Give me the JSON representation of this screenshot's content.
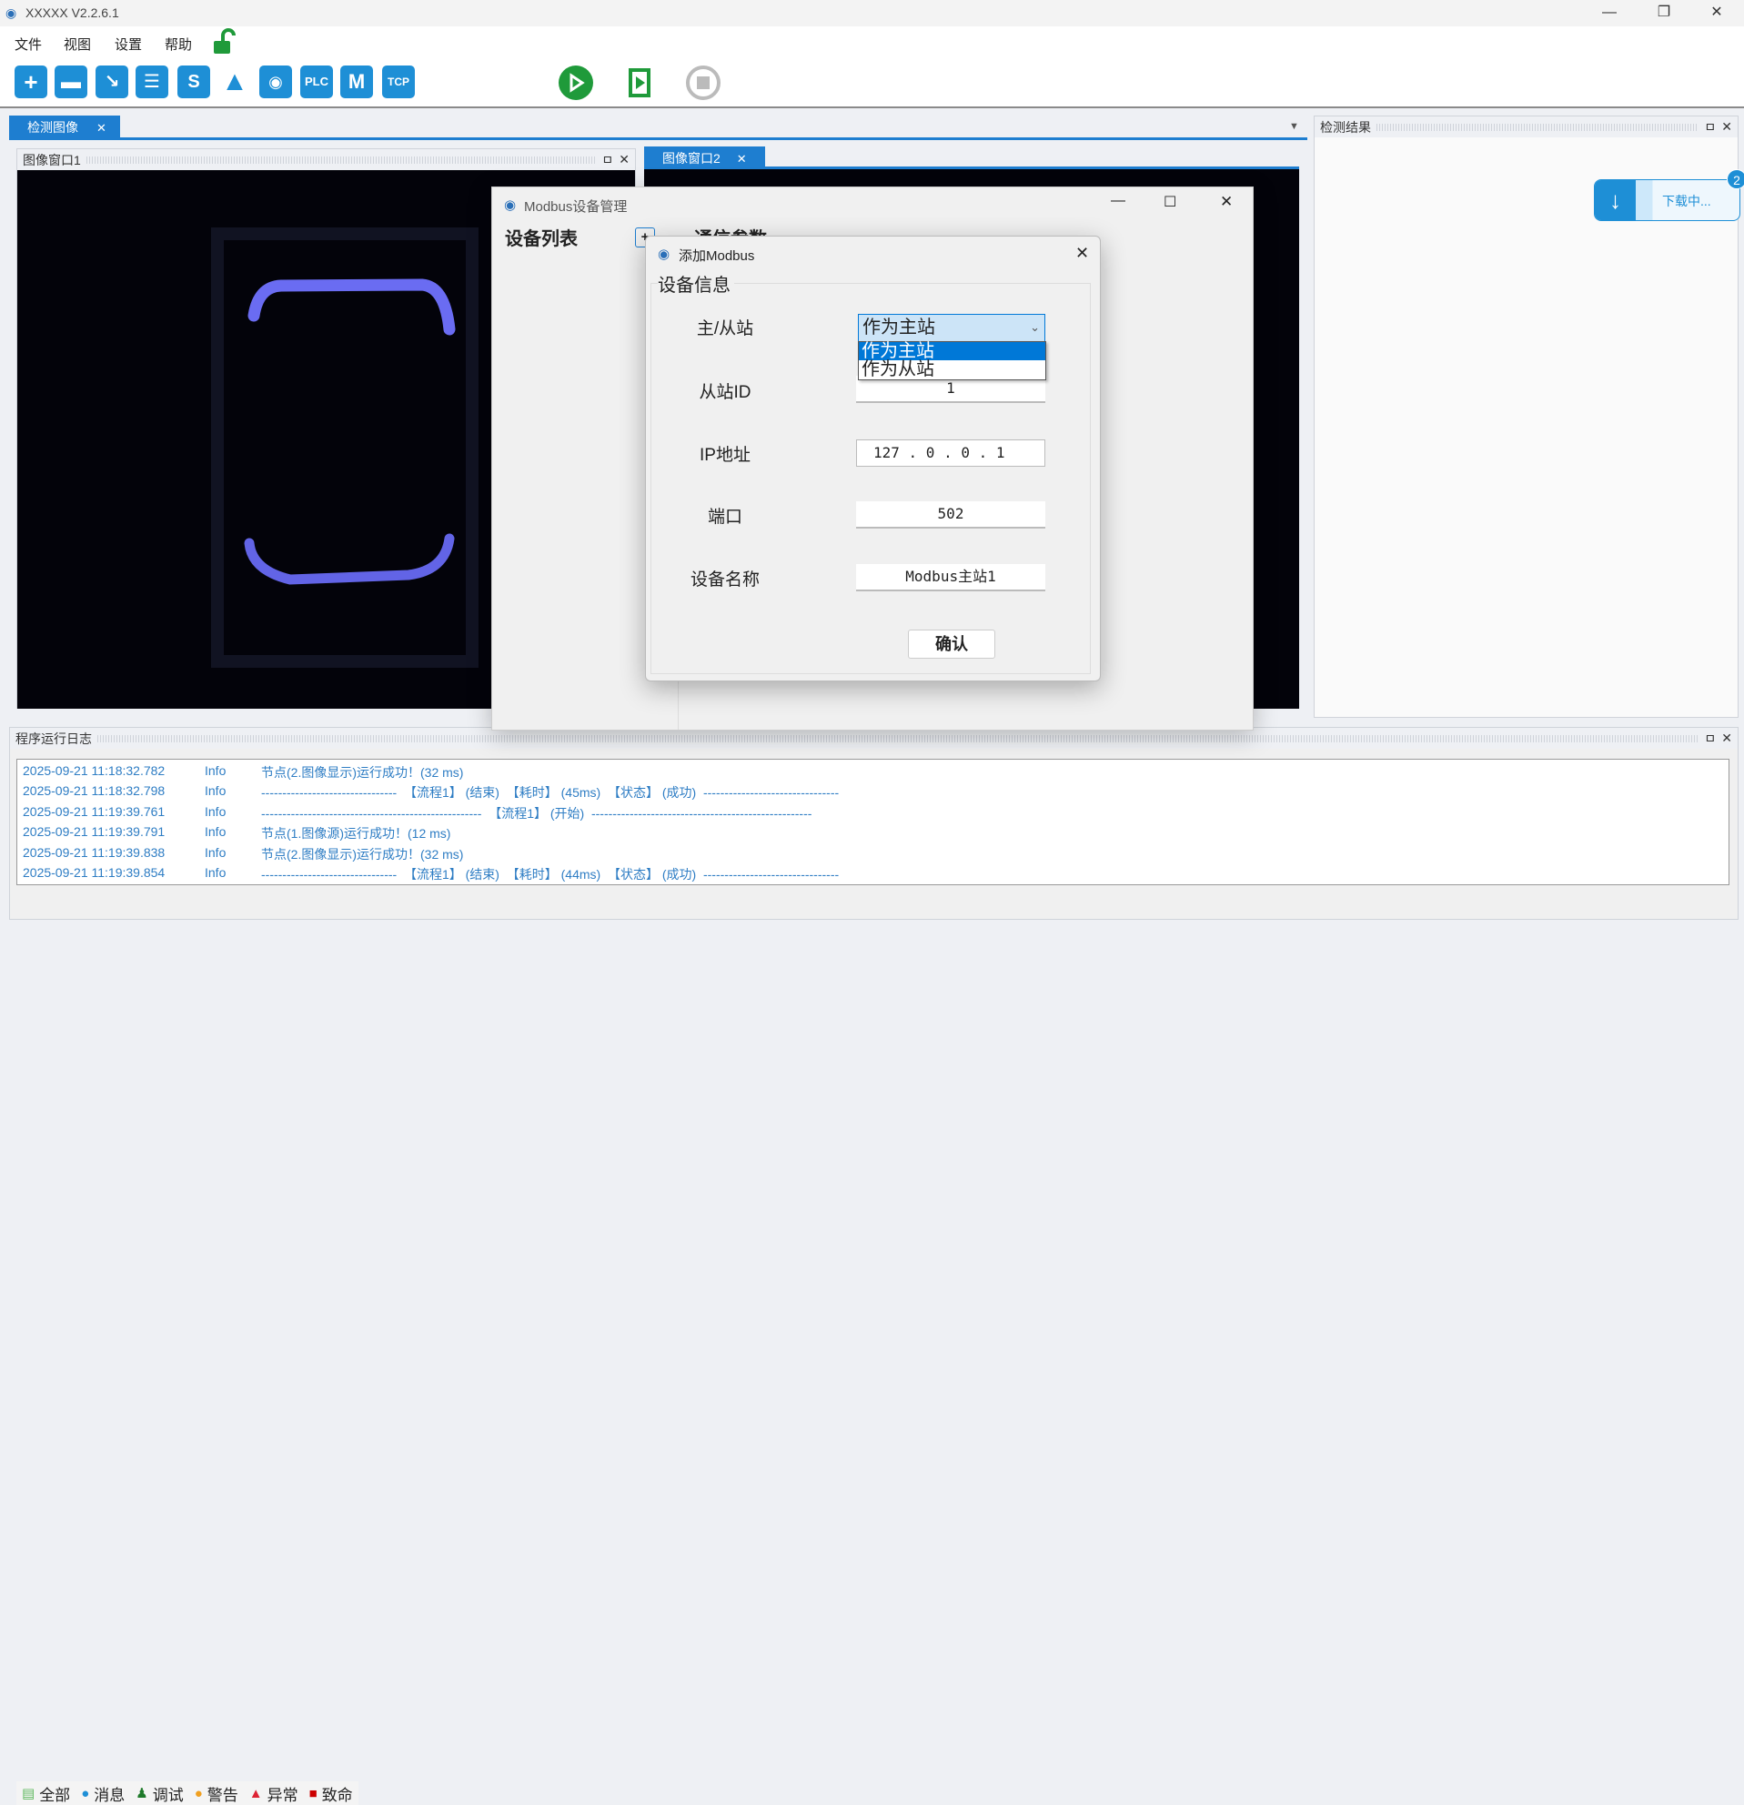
{
  "app": {
    "title": "XXXXX V2.2.6.1"
  },
  "menu": [
    "文件",
    "视图",
    "设置",
    "帮助"
  ],
  "toolbar": {
    "icons": [
      "new-file",
      "open-folder",
      "import",
      "save",
      "flow-switch",
      "light",
      "camera",
      "PLC",
      "M",
      "TCP"
    ],
    "plc": "PLC",
    "m": "M",
    "tcp": "TCP"
  },
  "tabs": {
    "main": "检测图像",
    "image1": "图像窗口1",
    "image2": "图像窗口2",
    "results": "检测结果",
    "log": "程序运行日志"
  },
  "download": {
    "label": "下载中...",
    "badge": "2",
    "progress": 0.4
  },
  "modbus_window": {
    "title": "Modbus设备管理",
    "device_list": "设备列表",
    "comm_params": "通信参数",
    "add": "+"
  },
  "add_dialog": {
    "title": "添加Modbus",
    "group": "设备信息",
    "labels": {
      "role": "主/从站",
      "slave_id": "从站ID",
      "ip": "IP地址",
      "port": "端口",
      "name": "设备名称"
    },
    "role_value": "作为主站",
    "role_options": [
      "作为主站",
      "作为从站"
    ],
    "slave_id": "1",
    "ip": "127 .  0  .  0  .  1",
    "port": "502",
    "name": "Modbus主站1",
    "confirm": "确认"
  },
  "log": [
    {
      "time": "2025-09-21 11:18:32.782",
      "level": "Info",
      "msg": "节点(2.图像显示)运行成功！(32 ms)"
    },
    {
      "time": "2025-09-21 11:18:32.798",
      "level": "Info",
      "msg": "--------------------------------  【流程1】 (结束)  【耗时】 (45ms)  【状态】 (成功)  --------------------------------"
    },
    {
      "time": "2025-09-21 11:19:39.761",
      "level": "Info",
      "msg": "----------------------------------------------------  【流程1】 (开始)  ----------------------------------------------------"
    },
    {
      "time": "2025-09-21 11:19:39.791",
      "level": "Info",
      "msg": "节点(1.图像源)运行成功！(12 ms)"
    },
    {
      "time": "2025-09-21 11:19:39.838",
      "level": "Info",
      "msg": "节点(2.图像显示)运行成功！(32 ms)"
    },
    {
      "time": "2025-09-21 11:19:39.854",
      "level": "Info",
      "msg": "--------------------------------  【流程1】 (结束)  【耗时】 (44ms)  【状态】 (成功)  --------------------------------"
    }
  ],
  "log_filters": [
    "全部",
    "消息",
    "调试",
    "警告",
    "异常",
    "致命"
  ]
}
